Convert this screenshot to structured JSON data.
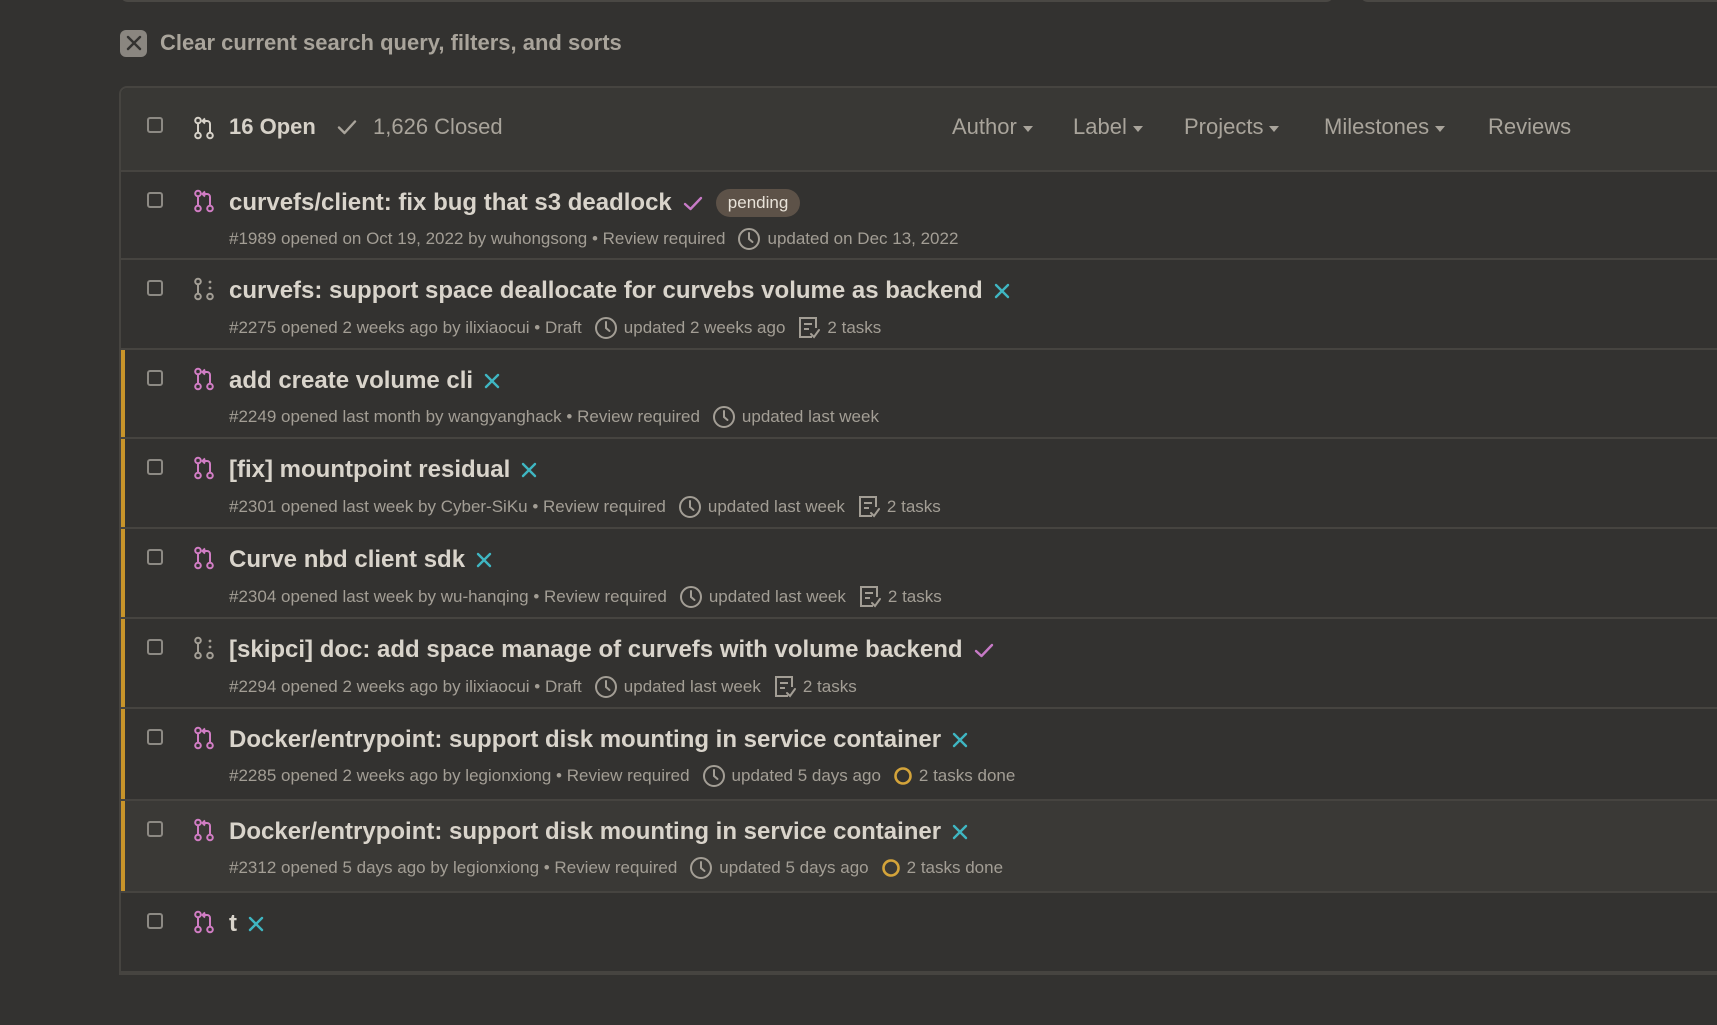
{
  "clear": {
    "label": "Clear current search query, filters, and sorts"
  },
  "header": {
    "open_label": "16 Open",
    "closed_label": "1,626 Closed",
    "filters": [
      "Author",
      "Label",
      "Projects",
      "Milestones",
      "Reviews"
    ]
  },
  "colors": {
    "pr_icon": "#d17dc4",
    "draft_icon": "#a39e95",
    "status_fail": "#3fb6c2",
    "status_success": "#c77ac6",
    "highlight": "#c8942a",
    "in_progress": "#d4a43a"
  },
  "rows": [
    {
      "title": "curvefs/client: fix bug that s3 deadlock",
      "status": "success",
      "badge": "pending",
      "meta_left": "#1989 opened on Oct 19, 2022 by wuhongsong • Review required",
      "updated": "updated on Dec 13, 2022",
      "tasks": "",
      "icon": "pr-open-icon"
    },
    {
      "title": "curvefs: support space deallocate for curvebs volume as backend",
      "status": "failure",
      "badge": "",
      "meta_left": "#2275 opened 2 weeks ago by ilixiaocui • Draft",
      "updated": "updated 2 weeks ago",
      "tasks": "2 tasks",
      "icon": "pr-draft-icon"
    },
    {
      "title": "add create volume cli",
      "status": "failure",
      "badge": "",
      "meta_left": "#2249 opened last month by wangyanghack • Review required",
      "updated": "updated last week",
      "tasks": "",
      "icon": "pr-open-icon"
    },
    {
      "title": "[fix] mountpoint residual",
      "status": "failure",
      "badge": "",
      "meta_left": "#2301 opened last week by Cyber-SiKu • Review required",
      "updated": "updated last week",
      "tasks": "2 tasks",
      "icon": "pr-open-icon"
    },
    {
      "title": "Curve nbd client sdk",
      "status": "failure",
      "badge": "",
      "meta_left": "#2304 opened last week by wu-hanqing • Review required",
      "updated": "updated last week",
      "tasks": "2 tasks",
      "icon": "pr-open-icon"
    },
    {
      "title": "[skipci] doc: add space manage of curvefs with volume backend",
      "status": "success",
      "badge": "",
      "meta_left": "#2294 opened 2 weeks ago by ilixiaocui • Draft",
      "updated": "updated last week",
      "tasks": "2 tasks",
      "icon": "pr-draft-icon"
    },
    {
      "title": "Docker/entrypoint: support disk mounting in service container",
      "status": "failure",
      "badge": "",
      "meta_left": "#2285 opened 2 weeks ago by legionxiong • Review required",
      "updated": "updated 5 days ago",
      "tasks_done": "2 tasks done",
      "icon": "pr-open-icon"
    },
    {
      "title": "Docker/entrypoint: support disk mounting in service container",
      "status": "failure",
      "badge": "",
      "meta_left": "#2312 opened 5 days ago by legionxiong • Review required",
      "updated": "updated 5 days ago",
      "tasks_done": "2 tasks done",
      "icon": "pr-open-icon"
    },
    {
      "title": "t",
      "status": "failure",
      "badge": "",
      "meta_left": "",
      "updated": "",
      "tasks": "",
      "icon": "pr-open-icon"
    }
  ]
}
